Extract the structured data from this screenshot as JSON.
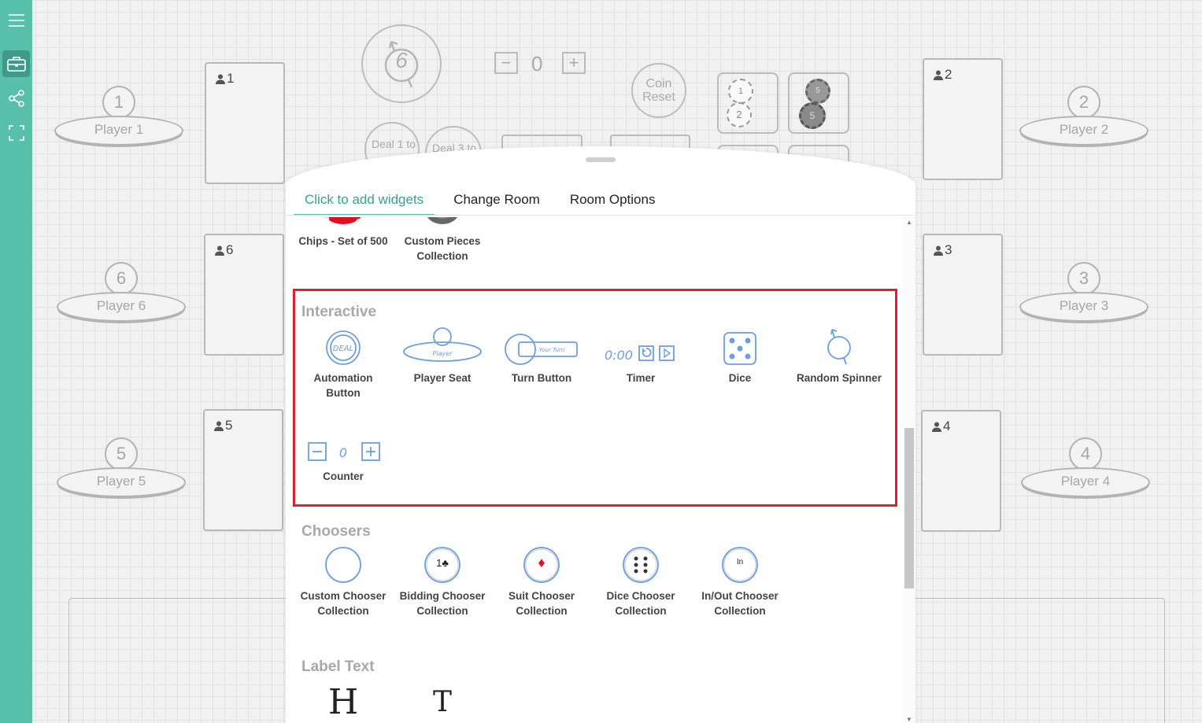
{
  "sidebar": {
    "items": [
      {
        "icon": "menu-icon"
      },
      {
        "icon": "briefcase-icon"
      },
      {
        "icon": "share-icon"
      },
      {
        "icon": "fullscreen-icon"
      }
    ]
  },
  "table": {
    "spinner_value": "6",
    "counter_value": "0",
    "coin_reset_label": "Coin Reset",
    "deal1_label": "Deal 1 to",
    "deal3_label": "Deal 3 to",
    "chip_values": [
      "1",
      "2",
      "5",
      "5"
    ],
    "seats": [
      {
        "number": "1",
        "label": "Player 1"
      },
      {
        "number": "2",
        "label": "Player 2"
      },
      {
        "number": "6",
        "label": "Player 6"
      },
      {
        "number": "3",
        "label": "Player 3"
      },
      {
        "number": "5",
        "label": "Player 5"
      },
      {
        "number": "4",
        "label": "Player 4"
      }
    ],
    "hands": [
      {
        "label": "1"
      },
      {
        "label": "2"
      },
      {
        "label": "6"
      },
      {
        "label": "3"
      },
      {
        "label": "5"
      },
      {
        "label": "4"
      }
    ]
  },
  "panel": {
    "tabs": [
      {
        "label": "Click to add widgets",
        "active": true
      },
      {
        "label": "Change Room",
        "active": false
      },
      {
        "label": "Room Options",
        "active": false
      }
    ],
    "prev_widgets": [
      {
        "name": "Chips - Set of 500",
        "icon": "red-chip-icon"
      },
      {
        "name": "Custom Pieces Collection",
        "icon": "gray-piece-icon"
      }
    ],
    "sections": {
      "interactive": {
        "title": "Interactive",
        "widgets": [
          {
            "name": "Automation Button",
            "icon": "deal-button-icon"
          },
          {
            "name": "Player Seat",
            "icon": "player-seat-icon"
          },
          {
            "name": "Turn Button",
            "icon": "turn-button-icon"
          },
          {
            "name": "Timer",
            "icon": "timer-icon"
          },
          {
            "name": "Dice",
            "icon": "dice-icon"
          },
          {
            "name": "Random Spinner",
            "icon": "spinner-icon"
          },
          {
            "name": "Counter",
            "icon": "counter-icon"
          }
        ],
        "icon_text": {
          "deal": "DEAL",
          "player": "Player",
          "your_turn": "Your Turn",
          "timer": "0:00",
          "counter": "0"
        }
      },
      "choosers": {
        "title": "Choosers",
        "widgets": [
          {
            "name": "Custom Chooser Collection",
            "icon": "custom-chooser-icon"
          },
          {
            "name": "Bidding Chooser Collection",
            "icon": "bidding-chooser-icon",
            "glyph": "1♣"
          },
          {
            "name": "Suit Chooser Collection",
            "icon": "suit-chooser-icon",
            "glyph": "♦"
          },
          {
            "name": "Dice Chooser Collection",
            "icon": "dice-chooser-icon"
          },
          {
            "name": "In/Out Chooser Collection",
            "icon": "inout-chooser-icon",
            "glyph": "In"
          }
        ]
      },
      "label_text": {
        "title": "Label Text",
        "widgets": [
          {
            "glyph": "H",
            "icon": "heading-icon"
          },
          {
            "glyph": "T",
            "icon": "text-icon"
          }
        ]
      }
    }
  },
  "colors": {
    "accent": "#58bfab",
    "highlight": "#e0202e",
    "icon_blue": "#6f9de0"
  }
}
